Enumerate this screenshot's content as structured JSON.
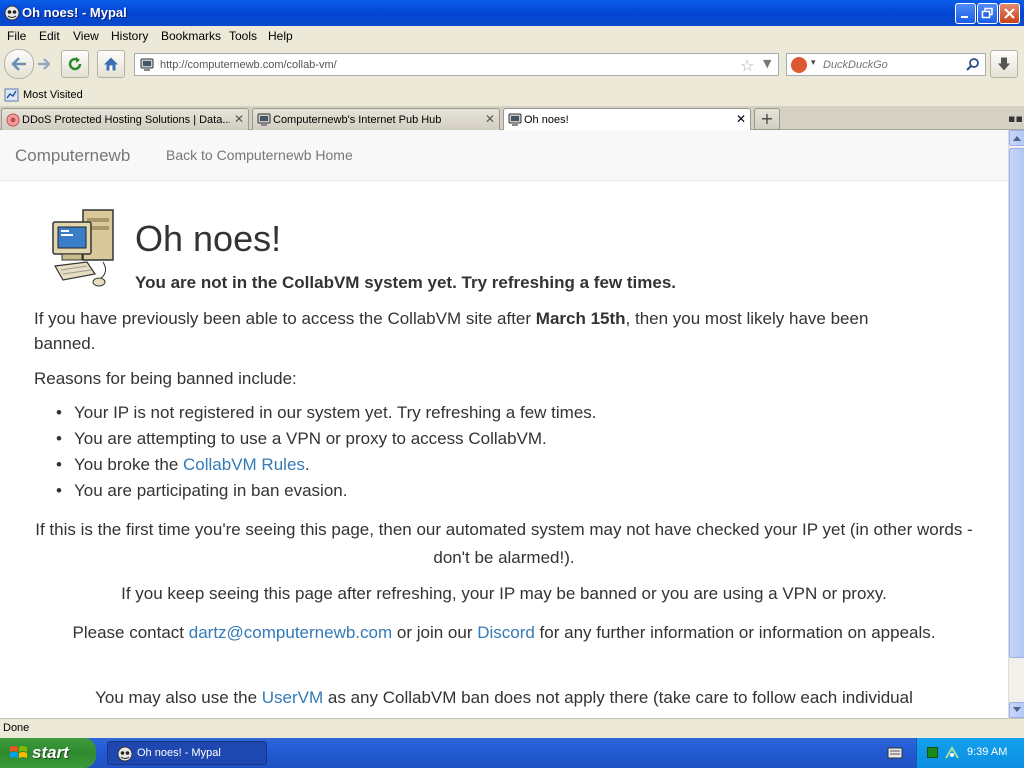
{
  "window": {
    "title": "Oh noes! - Mypal"
  },
  "menu": {
    "file": "File",
    "edit": "Edit",
    "view": "View",
    "history": "History",
    "bookmarks": "Bookmarks",
    "tools": "Tools",
    "help": "Help"
  },
  "navbar": {
    "url": "http://computernewb.com/collab-vm/",
    "search_placeholder": "DuckDuckGo"
  },
  "bookmarks": {
    "most_visited": "Most Visited"
  },
  "tabs": [
    {
      "label": "DDoS Protected Hosting Solutions | Data..."
    },
    {
      "label": "Computernewb's Internet Pub Hub"
    },
    {
      "label": "Oh noes!"
    }
  ],
  "page": {
    "brand": "Computernewb",
    "nav_link": "Back to Computernewb Home",
    "heading": "Oh noes!",
    "subheading": "You are not in the CollabVM system yet. Try refreshing a few times.",
    "p1_before": "If you have previously been able to access the CollabVM site after ",
    "p1_bold": "March 15th",
    "p1_after": ", then you most likely have been banned.",
    "reasons_intro": "Reasons for being banned include:",
    "reason_1": "Your IP is not registered in our system yet. Try refreshing a few times.",
    "reason_2": "You are attempting to use a VPN or proxy to access CollabVM.",
    "reason_3_before": "You broke the ",
    "reason_3_link": "CollabVM Rules",
    "reason_3_after": ".",
    "reason_4": "You are participating in ban evasion.",
    "p3": "If this is the first time you're seeing this page, then our automated system may not have checked your IP yet (in other words - don't be alarmed!).",
    "p4": "If you keep seeing this page after refreshing, your IP may be banned or you are using a VPN or proxy.",
    "p5_before": "Please contact ",
    "p5_email": "dartz@computernewb.com",
    "p5_mid": " or join our ",
    "p5_discord": "Discord",
    "p5_after": " for any further information or information on appeals.",
    "p6_before": "You may also use the ",
    "p6_link": "UserVM",
    "p6_after": " as any CollabVM ban does not apply there (take care to follow each individual"
  },
  "status": {
    "text": "Done"
  },
  "taskbar": {
    "start": "start",
    "task": "Oh noes! - Mypal",
    "clock": "9:39 AM"
  }
}
